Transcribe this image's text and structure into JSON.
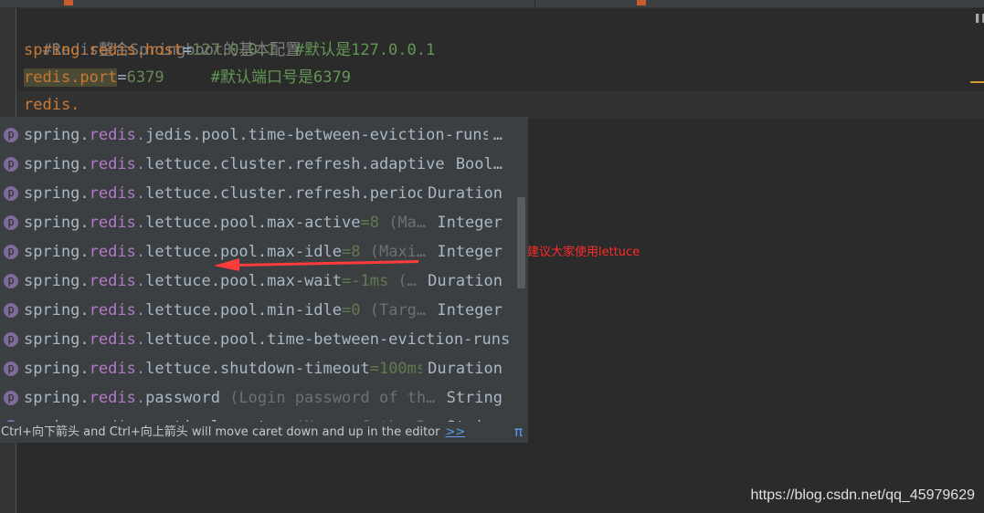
{
  "editor": {
    "lines": [
      {
        "comment": "#Redis整合Springboot的基本配置"
      },
      {
        "key": "spring.redis.host",
        "op": "=",
        "value": "127.0.0.1",
        "pad": "  ",
        "comment": "#默认是127.0.0.1"
      },
      {
        "key": "redis.port",
        "op": "=",
        "value": "6379",
        "pad": "     ",
        "comment": "#默认端口号是6379"
      },
      {
        "key": "redis."
      }
    ]
  },
  "completion": {
    "items": [
      {
        "prefix": "spring.",
        "match": "redis.",
        "rest": "jedis.pool.time-between-eviction-runs",
        "default": "",
        "desc": "",
        "type": "…"
      },
      {
        "prefix": "spring.",
        "match": "redis.",
        "rest": "lettuce.cluster.refresh.adaptive",
        "default": "",
        "desc": "",
        "type": "Bool…"
      },
      {
        "prefix": "spring.",
        "match": "redis.",
        "rest": "lettuce.cluster.refresh.period",
        "default": "",
        "desc": "",
        "type": "Duration"
      },
      {
        "prefix": "spring.",
        "match": "redis.",
        "rest": "lettuce.pool.max-active",
        "default": "=8",
        "desc": " (Ma…",
        "type": "Integer"
      },
      {
        "prefix": "spring.",
        "match": "redis.",
        "rest": "lettuce.pool.max-idle",
        "default": "=8",
        "desc": " (Maxi…",
        "type": "Integer"
      },
      {
        "prefix": "spring.",
        "match": "redis.",
        "rest": "lettuce.pool.max-wait",
        "default": "=-1ms",
        "desc": " (…",
        "type": "Duration"
      },
      {
        "prefix": "spring.",
        "match": "redis.",
        "rest": "lettuce.pool.min-idle",
        "default": "=0",
        "desc": " (Targ…",
        "type": "Integer"
      },
      {
        "prefix": "spring.",
        "match": "redis.",
        "rest": "lettuce.pool.time-between-eviction-runs",
        "default": "",
        "desc": "",
        "type": ""
      },
      {
        "prefix": "spring.",
        "match": "redis.",
        "rest": "lettuce.shutdown-timeout",
        "default": "=100ms",
        "desc": "",
        "type": "Duration"
      },
      {
        "prefix": "spring.",
        "match": "redis.",
        "rest": "password",
        "default": "",
        "desc": " (Login password of th…",
        "type": "String"
      },
      {
        "prefix": "spring.",
        "match": "redis.",
        "rest": "sentinel.master",
        "default": "",
        "desc": " (Name of the Redis…",
        "type": "String"
      }
    ],
    "icon_letter": "p",
    "footer_text": "Ctrl+向下箭头 and Ctrl+向上箭头 will move caret down and up in the editor",
    "footer_link": ">>",
    "pi_symbol": "π"
  },
  "annotation": {
    "text": "建议大家使用lettuce",
    "color": "#ff2a2a"
  },
  "watermark": "https://blog.csdn.net/qq_45979629"
}
